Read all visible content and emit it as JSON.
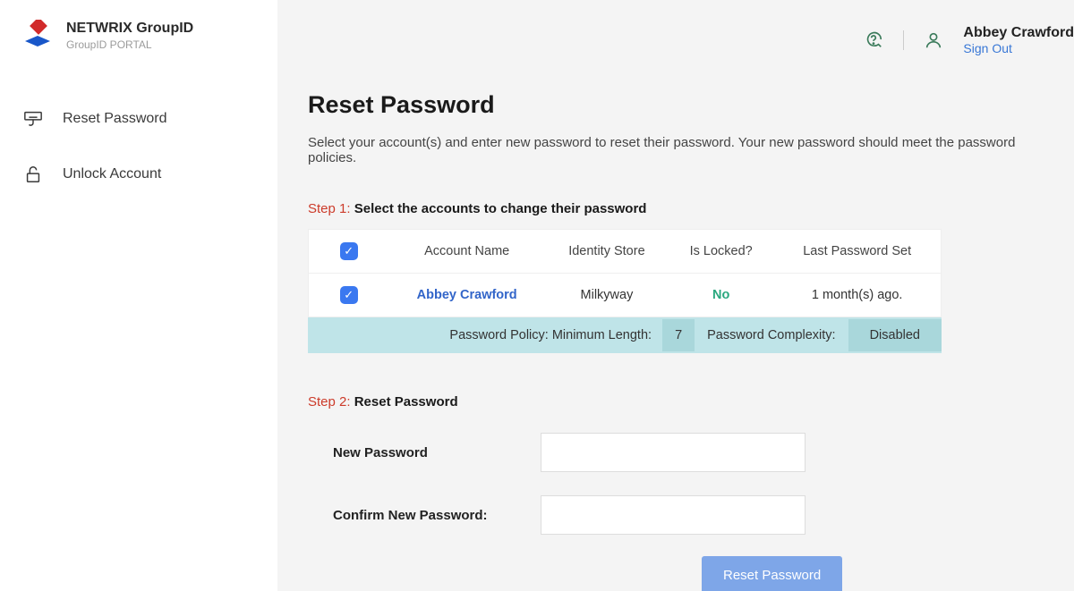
{
  "brand": {
    "name": "NETWRIX GroupID",
    "subtitle": "GroupID PORTAL"
  },
  "sidebar": {
    "items": [
      {
        "label": "Reset Password"
      },
      {
        "label": "Unlock Account"
      }
    ]
  },
  "header": {
    "user_name": "Abbey Crawford",
    "sign_out": "Sign Out"
  },
  "page": {
    "title": "Reset Password",
    "description": "Select your account(s) and enter new password to reset their password. Your new password should meet the password policies."
  },
  "step1": {
    "prefix": "Step 1:",
    "label": "Select the accounts to change their password",
    "columns": {
      "account_name": "Account Name",
      "identity_store": "Identity Store",
      "is_locked": "Is Locked?",
      "last_password_set": "Last Password Set"
    },
    "rows": [
      {
        "account_name": "Abbey Crawford",
        "identity_store": "Milkyway",
        "is_locked": "No",
        "last_password_set": "1 month(s) ago."
      }
    ],
    "policy": {
      "min_length_label": "Password Policy: Minimum Length:",
      "min_length_value": "7",
      "complexity_label": "Password Complexity:",
      "complexity_value": "Disabled"
    }
  },
  "step2": {
    "prefix": "Step 2:",
    "label": "Reset Password",
    "new_password_label": "New Password",
    "confirm_password_label": "Confirm New Password:",
    "button": "Reset Password"
  }
}
